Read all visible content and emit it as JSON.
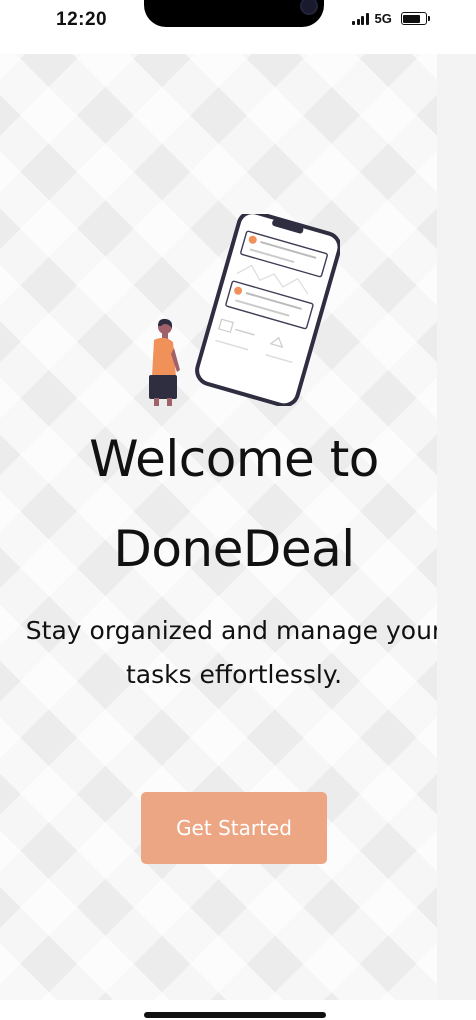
{
  "status_bar": {
    "time": "12:20",
    "network": "5G"
  },
  "welcome": {
    "title": "Welcome to DoneDeal",
    "subtitle": "Stay organized and manage your tasks effortlessly."
  },
  "actions": {
    "get_started_label": "Get Started"
  },
  "icons": {
    "signal": "signal-bars-icon",
    "battery": "battery-icon",
    "illustration": "person-with-phone-illustration"
  },
  "colors": {
    "accent": "#eda683",
    "illustration_orange": "#f0915a",
    "text": "#111111"
  }
}
